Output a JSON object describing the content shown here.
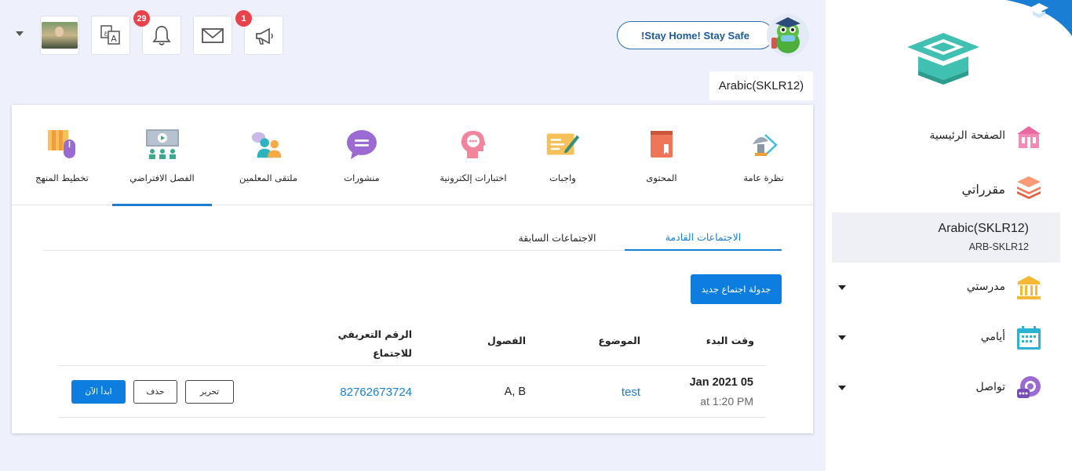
{
  "header": {
    "badges": {
      "notifications": "29",
      "announcements": "1"
    },
    "stay_safe": "!Stay Home! Stay Safe",
    "course_title": "Arabic(SKLR12)",
    "icons": [
      "dropdown-caret",
      "profile-photo",
      "translate-icon",
      "bell-icon",
      "envelope-icon",
      "megaphone-icon",
      "mascot-avatar"
    ]
  },
  "tabs": [
    {
      "label": "نظرة عامة",
      "icon": "overview-icon"
    },
    {
      "label": "المحتوى",
      "icon": "book-icon"
    },
    {
      "label": "واجبات",
      "icon": "assignment-icon"
    },
    {
      "label": "اختبارات إلكترونية",
      "icon": "quiz-icon"
    },
    {
      "label": "منشورات",
      "icon": "chat-bubble-icon"
    },
    {
      "label": "ملتقى المعلمين",
      "icon": "teachers-icon"
    },
    {
      "label": "الفصل الافتراضي",
      "icon": "virtual-class-icon",
      "active": true
    },
    {
      "label": "تخطيط المنهج",
      "icon": "curriculum-icon"
    }
  ],
  "meetings": {
    "subtabs": {
      "upcoming": "الاجتماعات القادمة",
      "previous": "الاجتماعات السابقة"
    },
    "schedule_button": "جدولة اجتماع جديد",
    "columns": {
      "start_time": "وقت البدء",
      "topic": "الموضوع",
      "classes": "الفصول",
      "meeting_id_line1": "الرقم التعريفي",
      "meeting_id_line2": "للاجتماع"
    },
    "rows": [
      {
        "date": "Jan 2021 05",
        "time": "at 1:20 PM",
        "topic": "test",
        "classes": "A, B",
        "meeting_id": "82762673724",
        "edit_label": "تحرير",
        "delete_label": "حذف",
        "start_label": "ابدأ الآن"
      }
    ]
  },
  "sidebar": {
    "home": "الصفحة الرئيسية",
    "courses": "مقرراتي",
    "current_course": {
      "name": "Arabic(SKLR12)",
      "code": "ARB-SKLR12"
    },
    "school": "مدرستي",
    "days": "أيامي",
    "communicate": "تواصل"
  },
  "colors": {
    "accent": "#0d7ee0",
    "badge": "#e8424b",
    "logo": "#3fc0b0"
  }
}
